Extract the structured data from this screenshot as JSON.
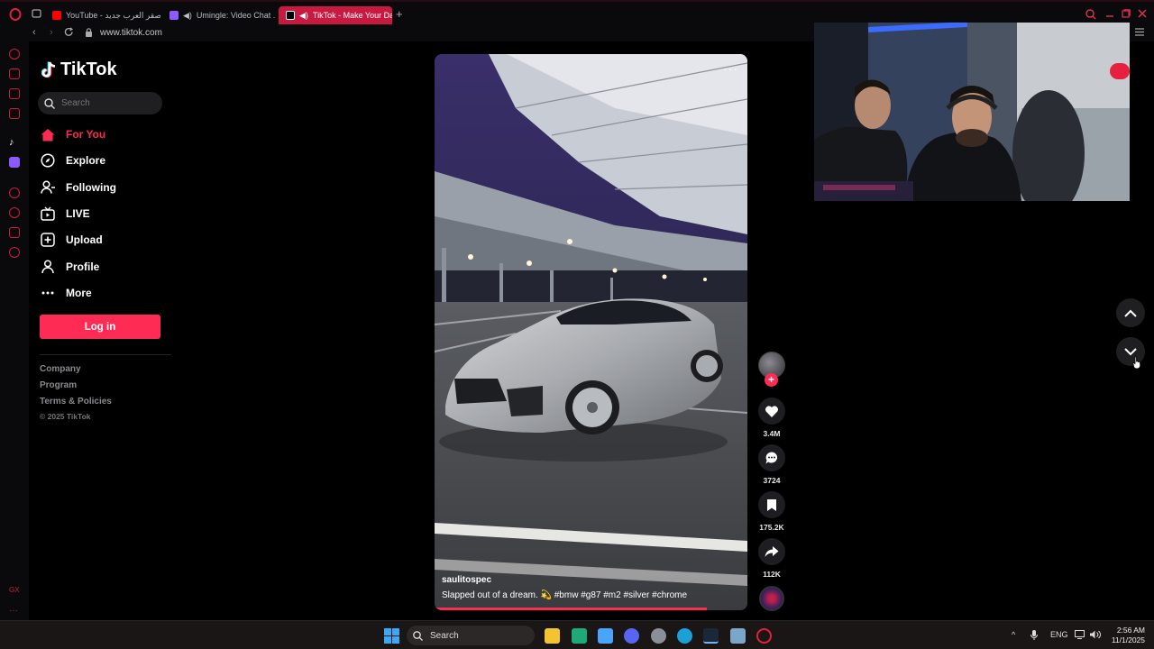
{
  "browser": {
    "tabs": [
      {
        "title": "YouTube - صقر العرب جديد",
        "active": false
      },
      {
        "title": "Umingle: Video Chat ...",
        "active": false
      },
      {
        "title": "TikTok - Make Your Da...",
        "active": true
      }
    ],
    "new_tab": "+",
    "url": "www.tiktok.com"
  },
  "tiktok": {
    "logo": "TikTok",
    "search_placeholder": "Search",
    "nav": [
      {
        "label": "For You",
        "icon": "home-icon",
        "active": true
      },
      {
        "label": "Explore",
        "icon": "compass-icon",
        "active": false
      },
      {
        "label": "Following",
        "icon": "following-icon",
        "active": false
      },
      {
        "label": "LIVE",
        "icon": "live-tv-icon",
        "active": false
      },
      {
        "label": "Upload",
        "icon": "upload-icon",
        "active": false
      },
      {
        "label": "Profile",
        "icon": "profile-icon",
        "active": false
      },
      {
        "label": "More",
        "icon": "more-icon",
        "active": false
      }
    ],
    "login": "Log in",
    "footer": [
      "Company",
      "Program",
      "Terms & Policies"
    ],
    "copyright": "© 2025 TikTok",
    "accent": "#fe2c55"
  },
  "video": {
    "author": "saulitospec",
    "caption": "Slapped out of a dream. 💫 #bmw #g87 #m2 #silver #chrome",
    "more": "···",
    "progress": 0.87
  },
  "actions": {
    "follow": "+",
    "likes": "3.4M",
    "comments": "3724",
    "saves": "175.2K",
    "shares": "112K"
  },
  "taskbar": {
    "search": "Search",
    "lang": "ENG",
    "time": "2:56 AM",
    "date": "11/1/2025"
  }
}
